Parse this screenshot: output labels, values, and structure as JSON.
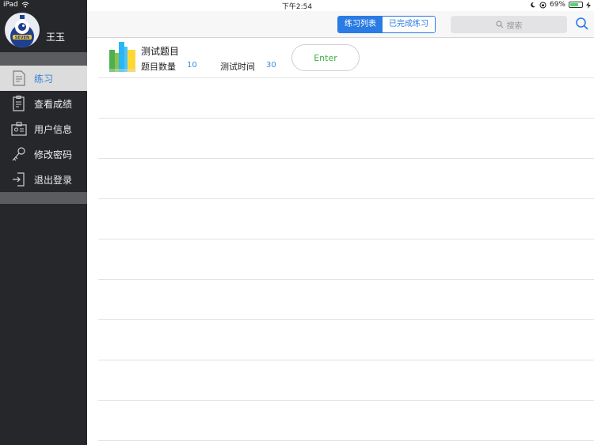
{
  "status_bar": {
    "device": "iPad",
    "time": "下午2:54",
    "battery_percent": "69%",
    "battery_level": 0.69
  },
  "sidebar": {
    "avatar_text": "SEVEN",
    "username": "王玉",
    "menu": [
      {
        "label": "练习",
        "icon": "document-icon",
        "active": true
      },
      {
        "label": "查看成绩",
        "icon": "clipboard-icon",
        "active": false
      },
      {
        "label": "用户信息",
        "icon": "id-card-icon",
        "active": false
      },
      {
        "label": "修改密码",
        "icon": "key-icon",
        "active": false
      },
      {
        "label": "退出登录",
        "icon": "logout-icon",
        "active": false
      }
    ]
  },
  "navbar": {
    "tabs": [
      {
        "label": "练习列表",
        "active": true
      },
      {
        "label": "已完成练习",
        "active": false
      }
    ],
    "search_placeholder": "搜索"
  },
  "list": {
    "items": [
      {
        "title": "测试题目",
        "count_label": "题目数量",
        "count_value": "10",
        "time_label": "测试时间",
        "time_value": "30",
        "action_label": "Enter"
      }
    ],
    "empty_rows": 9
  },
  "colors": {
    "accent": "#2a7be4",
    "sidebar_bg": "#26272b",
    "enter_text": "#3cb043",
    "value_text": "#3a8be0"
  }
}
